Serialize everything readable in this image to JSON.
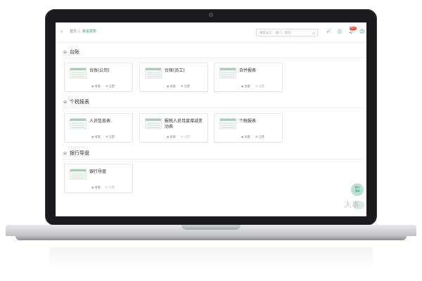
{
  "header": {
    "back_icon": "chevron-left-icon",
    "breadcrumb": [
      "首页",
      "/",
      "薪资报表"
    ],
    "search_placeholder": "搜索员工、部门、职位",
    "icons": [
      "check-circle-icon",
      "clock-icon",
      "bell-icon",
      "user-icon"
    ],
    "notification_badge": "99+"
  },
  "sections": [
    {
      "title": "台账",
      "cards": [
        {
          "title": "台账(公司)",
          "view_label": "查看",
          "settings_label": "设置",
          "settings_enabled": true
        },
        {
          "title": "台账(员工)",
          "view_label": "查看",
          "settings_label": "设置",
          "settings_enabled": true
        },
        {
          "title": "合并报表",
          "view_label": "查看",
          "settings_label": "设置",
          "settings_enabled": false
        }
      ]
    },
    {
      "title": "个税报表",
      "cards": [
        {
          "title": "人员信息表",
          "view_label": "查看",
          "settings_label": "设置",
          "settings_enabled": true
        },
        {
          "title": "报税人员月度增减变动表",
          "view_label": "查看",
          "settings_label": "设置",
          "settings_enabled": false
        },
        {
          "title": "个税报表",
          "view_label": "查看",
          "settings_label": "设置",
          "settings_enabled": true
        }
      ]
    },
    {
      "title": "银行导盘",
      "cards": [
        {
          "title": "银行导盘",
          "view_label": "查看",
          "settings_label": "设置",
          "settings_enabled": false
        }
      ]
    }
  ],
  "floating": {
    "help_label_line1": "操作",
    "help_label_line2": "指南",
    "watermark": "人事"
  },
  "colors": {
    "accent": "#3aa58b",
    "badge": "#e84c3d",
    "laptop_frame": "#1b1b1d"
  }
}
